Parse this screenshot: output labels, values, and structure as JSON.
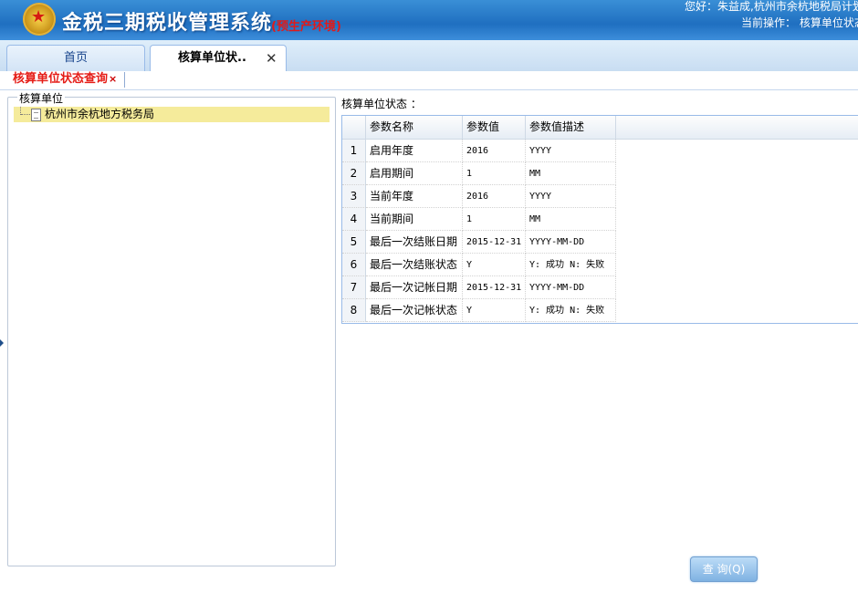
{
  "header": {
    "system_title": "金税三期税收管理系统",
    "environment": "(预生产环境)",
    "emblem_icon": "national-emblem-icon",
    "user_greeting": "您好：朱益成,杭州市余杭地税局计划",
    "current_operation": "当前操作： 核算单位状态"
  },
  "tabs": {
    "home_label": "首页",
    "active_label": "核算单位状..",
    "close_glyph": "✕"
  },
  "subtab": {
    "label": "核算单位状态查询",
    "close_glyph": "×"
  },
  "left_panel": {
    "legend": "核算单位",
    "tree": [
      {
        "label": "杭州市余杭地方税务局",
        "icon": "document-icon",
        "selected": true
      }
    ]
  },
  "main": {
    "status_label": "核算单位状态 ：",
    "columns": [
      "参数名称",
      "参数值",
      "参数值描述"
    ],
    "rows": [
      {
        "num": "1",
        "name": "启用年度",
        "value": "2016",
        "desc": "YYYY"
      },
      {
        "num": "2",
        "name": "启用期间",
        "value": "1",
        "desc": "MM"
      },
      {
        "num": "3",
        "name": "当前年度",
        "value": "2016",
        "desc": "YYYY"
      },
      {
        "num": "4",
        "name": "当前期间",
        "value": "1",
        "desc": "MM"
      },
      {
        "num": "5",
        "name": "最后一次结账日期",
        "value": "2015-12-31",
        "desc": "YYYY-MM-DD"
      },
      {
        "num": "6",
        "name": "最后一次结账状态",
        "value": "Y",
        "desc": "Y: 成功 N: 失败"
      },
      {
        "num": "7",
        "name": "最后一次记帐日期",
        "value": "2015-12-31",
        "desc": "YYYY-MM-DD"
      },
      {
        "num": "8",
        "name": "最后一次记帐状态",
        "value": "Y",
        "desc": "Y: 成功 N: 失败"
      }
    ]
  },
  "buttons": {
    "query_label": "查 询(Q)"
  },
  "colors": {
    "header_blue": "#1f6fc0",
    "env_red": "#e11a1a",
    "selected_tree_row": "#f5eb9b",
    "grid_border": "#99bbe8"
  }
}
